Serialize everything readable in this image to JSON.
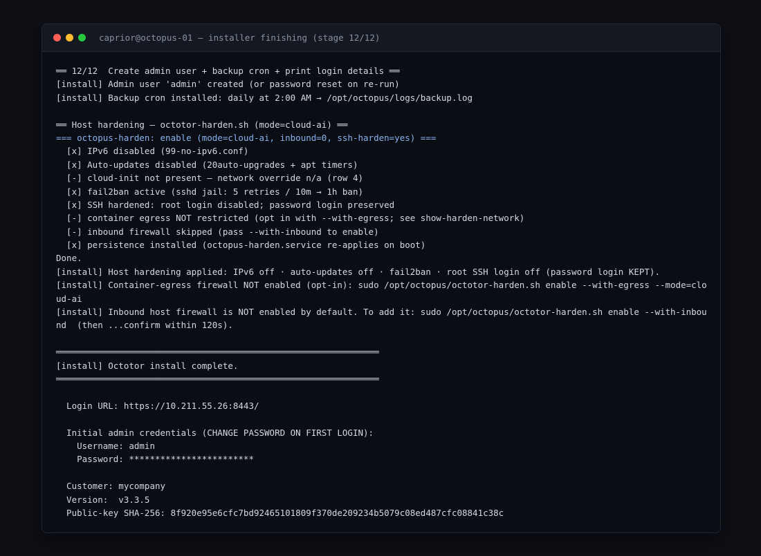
{
  "window": {
    "title": "caprior@octopus-01 — installer finishing (stage 12/12)",
    "buttons": [
      {
        "name": "close",
        "color": "#ff5f57"
      },
      {
        "name": "minimize",
        "color": "#febc2e"
      },
      {
        "name": "maximize",
        "color": "#28c840"
      }
    ]
  },
  "terminal": {
    "lines": [
      {
        "text": "══ 12/12  Create admin user + backup cron + print login details ══"
      },
      {
        "text": "[install] Admin user 'admin' created (or password reset on re-run)"
      },
      {
        "text": "[install] Backup cron installed: daily at 2:00 AM → /opt/octopus/logs/backup.log"
      },
      {
        "text": ""
      },
      {
        "text": "══ Host hardening — octotor-harden.sh (mode=cloud-ai) ══"
      },
      {
        "text": "=== octopus-harden: enable (mode=cloud-ai, inbound=0, ssh-harden=yes) ===",
        "style": "accent"
      },
      {
        "text": "  [x] IPv6 disabled (99-no-ipv6.conf)"
      },
      {
        "text": "  [x] Auto-updates disabled (20auto-upgrades + apt timers)"
      },
      {
        "text": "  [-] cloud-init not present — network override n/a (row 4)"
      },
      {
        "text": "  [x] fail2ban active (sshd jail: 5 retries / 10m → 1h ban)"
      },
      {
        "text": "  [x] SSH hardened: root login disabled; password login preserved"
      },
      {
        "text": "  [-] container egress NOT restricted (opt in with --with-egress; see show-harden-network)"
      },
      {
        "text": "  [-] inbound firewall skipped (pass --with-inbound to enable)"
      },
      {
        "text": "  [x] persistence installed (octopus-harden.service re-applies on boot)"
      },
      {
        "text": "Done."
      },
      {
        "text": "[install] Host hardening applied: IPv6 off · auto-updates off · fail2ban · root SSH login off (password login KEPT)."
      },
      {
        "text": "[install] Container-egress firewall NOT enabled (opt-in): sudo /opt/octopus/octotor-harden.sh enable --with-egress --mode=clo"
      },
      {
        "text": "ud-ai"
      },
      {
        "text": "[install] Inbound host firewall is NOT enabled by default. To add it: sudo /opt/octopus/octotor-harden.sh enable --with-inbou"
      },
      {
        "text": "nd  (then ...confirm within 120s)."
      },
      {
        "text": ""
      },
      {
        "text": "══════════════════════════════════════════════════════════════",
        "style": "rule"
      },
      {
        "text": "[install] Octotor install complete."
      },
      {
        "text": "══════════════════════════════════════════════════════════════",
        "style": "rule"
      },
      {
        "text": ""
      },
      {
        "text": "  Login URL: https://10.211.55.26:8443/"
      },
      {
        "text": ""
      },
      {
        "text": "  Initial admin credentials (CHANGE PASSWORD ON FIRST LOGIN):"
      },
      {
        "text": "    Username: admin"
      },
      {
        "text": "    Password: ************************"
      },
      {
        "text": ""
      },
      {
        "text": "  Customer: mycompany"
      },
      {
        "text": "  Version:  v3.3.5"
      },
      {
        "text": "  Public-key SHA-256: 8f920e95e6cfc7bd92465101809f370de209234b5079c08ed487cfc08841c38c"
      }
    ]
  }
}
